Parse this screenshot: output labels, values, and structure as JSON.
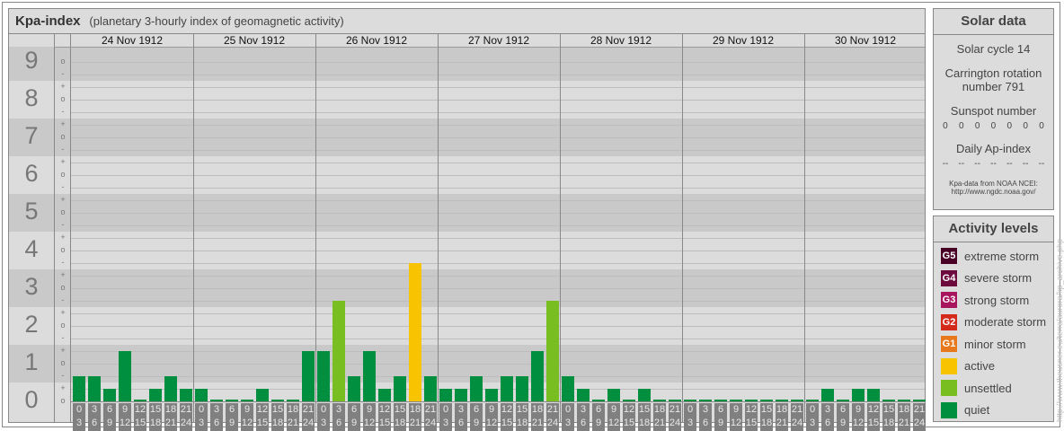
{
  "header": {
    "title": "Kpa-index",
    "subtitle": "(planetary 3-hourly index of geomagnetic activity)"
  },
  "chart_data": {
    "type": "bar",
    "title": "Kpa-index",
    "ylabel": "Kp",
    "ylim": [
      0,
      9
    ],
    "y_ticks": [
      "0",
      "1",
      "2",
      "3",
      "4",
      "5",
      "6",
      "7",
      "8",
      "9"
    ],
    "sub_ticks": [
      "-",
      "o",
      "+"
    ],
    "days": [
      "24 Nov 1912",
      "25 Nov 1912",
      "26 Nov 1912",
      "27 Nov 1912",
      "28 Nov 1912",
      "29 Nov 1912",
      "30 Nov 1912"
    ],
    "intervals": [
      [
        "0",
        "3"
      ],
      [
        "3",
        "6"
      ],
      [
        "6",
        "9"
      ],
      [
        "9",
        "12"
      ],
      [
        "12",
        "15"
      ],
      [
        "15",
        "18"
      ],
      [
        "18",
        "21"
      ],
      [
        "21",
        "24"
      ]
    ],
    "values": [
      [
        "1-",
        "1-",
        "0+",
        "1+",
        "0o",
        "0+",
        "1-",
        "0+"
      ],
      [
        "0+",
        "0o",
        "0o",
        "0o",
        "0+",
        "0o",
        "0o",
        "1+"
      ],
      [
        "1+",
        "3-",
        "1-",
        "1+",
        "0+",
        "1-",
        "4-",
        "1-"
      ],
      [
        "0+",
        "0+",
        "1-",
        "0+",
        "1-",
        "1-",
        "1+",
        "3-"
      ],
      [
        "1-",
        "0+",
        "0o",
        "0+",
        "0o",
        "0+",
        "0o",
        "0o"
      ],
      [
        "0o",
        "0o",
        "0o",
        "0o",
        "0o",
        "0o",
        "0o",
        "0o"
      ],
      [
        "0o",
        "0+",
        "0o",
        "0+",
        "0+",
        "0o",
        "0o",
        "0o"
      ]
    ],
    "colors": {
      "quiet": "#008f3f",
      "unsettled": "#78be20",
      "active": "#f8c300",
      "band_dark": "#c9c9c9",
      "band_light": "#dcdcdc"
    }
  },
  "solar": {
    "title": "Solar data",
    "cycle": "Solar cycle 14",
    "carrington_1": "Carrington rotation",
    "carrington_2": "number 791",
    "sunspot_label": "Sunspot number",
    "sunspots": [
      "0",
      "0",
      "0",
      "0",
      "0",
      "0",
      "0"
    ],
    "ap_label": "Daily Ap-index",
    "ap": [
      "--",
      "--",
      "--",
      "--",
      "--",
      "--",
      "--"
    ],
    "source_1": "Kpa-data from NOAA NCEI:",
    "source_2": "http://www.ngdc.noaa.gov/"
  },
  "legend": {
    "title": "Activity levels",
    "items": [
      {
        "badge": "G5",
        "label": "extreme storm",
        "color": "#4a0026"
      },
      {
        "badge": "G4",
        "label": "severe storm",
        "color": "#6d0a3d"
      },
      {
        "badge": "G3",
        "label": "strong storm",
        "color": "#a8145e"
      },
      {
        "badge": "G2",
        "label": "moderate storm",
        "color": "#d42a1c"
      },
      {
        "badge": "G1",
        "label": "minor storm",
        "color": "#e8781c"
      },
      {
        "badge": "",
        "label": "active",
        "color": "#f8c300"
      },
      {
        "badge": "",
        "label": "unsettled",
        "color": "#78be20"
      },
      {
        "badge": "",
        "label": "quiet",
        "color": "#008f3f"
      }
    ]
  },
  "watermark": "http://www.theusner.eu/terra/aurora/kp_archive.php"
}
